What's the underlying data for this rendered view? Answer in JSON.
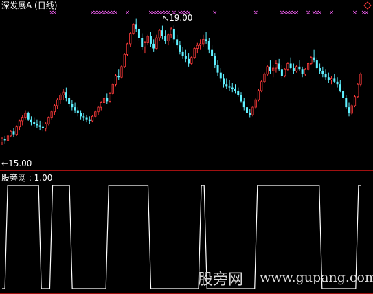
{
  "window": {
    "title": "深发展A (日线)"
  },
  "indicator": {
    "label": "股旁网 : 1.00"
  },
  "watermark": {
    "cn": "股旁网",
    "url": "www.gupang.com"
  },
  "annotations": {
    "high": "19.00",
    "low": "15.00"
  },
  "colors": {
    "up": "#ff3b3b",
    "down": "#5ff0ff",
    "marker": "#ff66ff",
    "divider": "#a01010",
    "signal": "#ffffff",
    "diamond": "#ff3b3b"
  },
  "chart_data": [
    {
      "type": "candlestick",
      "title": "深发展A (日线)",
      "ylim": [
        14.8,
        19.4
      ],
      "annotations": [
        {
          "label": "19.00",
          "index": 59,
          "value": 19.0
        },
        {
          "label": "15.00",
          "index": 0,
          "value": 15.0
        }
      ],
      "values": [
        [
          15.15,
          15.3,
          15.05,
          15.25
        ],
        [
          15.25,
          15.35,
          15.1,
          15.2
        ],
        [
          15.2,
          15.4,
          15.15,
          15.35
        ],
        [
          15.35,
          15.55,
          15.3,
          15.5
        ],
        [
          15.5,
          15.6,
          15.3,
          15.4
        ],
        [
          15.4,
          15.7,
          15.35,
          15.65
        ],
        [
          15.65,
          15.9,
          15.55,
          15.85
        ],
        [
          15.85,
          16.05,
          15.7,
          15.95
        ],
        [
          15.95,
          16.2,
          15.9,
          16.1
        ],
        [
          16.1,
          16.15,
          15.85,
          15.9
        ],
        [
          15.9,
          16.0,
          15.7,
          15.8
        ],
        [
          15.8,
          15.95,
          15.65,
          15.75
        ],
        [
          15.75,
          15.9,
          15.6,
          15.7
        ],
        [
          15.7,
          15.85,
          15.55,
          15.65
        ],
        [
          15.65,
          15.8,
          15.5,
          15.6
        ],
        [
          15.6,
          15.8,
          15.5,
          15.75
        ],
        [
          15.75,
          16.0,
          15.7,
          15.95
        ],
        [
          15.95,
          16.2,
          15.9,
          16.15
        ],
        [
          16.15,
          16.4,
          16.05,
          16.35
        ],
        [
          16.35,
          16.6,
          16.25,
          16.55
        ],
        [
          16.55,
          16.75,
          16.4,
          16.7
        ],
        [
          16.7,
          16.9,
          16.55,
          16.8
        ],
        [
          16.8,
          16.95,
          16.5,
          16.6
        ],
        [
          16.6,
          16.7,
          16.3,
          16.4
        ],
        [
          16.4,
          16.55,
          16.2,
          16.3
        ],
        [
          16.3,
          16.45,
          16.1,
          16.2
        ],
        [
          16.2,
          16.3,
          16.0,
          16.1
        ],
        [
          16.1,
          16.2,
          15.9,
          16.0
        ],
        [
          16.0,
          16.1,
          15.85,
          15.95
        ],
        [
          15.95,
          16.05,
          15.8,
          15.9
        ],
        [
          15.9,
          16.0,
          15.75,
          15.85
        ],
        [
          15.85,
          16.05,
          15.8,
          16.0
        ],
        [
          16.0,
          16.2,
          15.95,
          16.15
        ],
        [
          16.15,
          16.35,
          16.05,
          16.3
        ],
        [
          16.3,
          16.5,
          16.2,
          16.45
        ],
        [
          16.45,
          16.65,
          16.35,
          16.6
        ],
        [
          16.6,
          16.75,
          16.4,
          16.5
        ],
        [
          16.5,
          16.8,
          16.45,
          16.75
        ],
        [
          16.75,
          17.1,
          16.7,
          17.05
        ],
        [
          17.05,
          17.4,
          17.0,
          17.35
        ],
        [
          17.35,
          17.55,
          17.2,
          17.3
        ],
        [
          17.3,
          17.7,
          17.25,
          17.65
        ],
        [
          17.65,
          18.1,
          17.6,
          18.05
        ],
        [
          18.05,
          18.45,
          18.0,
          18.4
        ],
        [
          18.4,
          18.8,
          18.3,
          18.75
        ],
        [
          18.75,
          19.1,
          18.7,
          19.05
        ],
        [
          19.05,
          19.25,
          18.8,
          18.9
        ],
        [
          18.9,
          19.0,
          18.5,
          18.6
        ],
        [
          18.6,
          18.75,
          18.2,
          18.3
        ],
        [
          18.3,
          18.5,
          18.1,
          18.45
        ],
        [
          18.45,
          18.7,
          18.35,
          18.65
        ],
        [
          18.65,
          18.8,
          18.3,
          18.4
        ],
        [
          18.4,
          18.55,
          18.15,
          18.25
        ],
        [
          18.25,
          18.7,
          18.2,
          18.6
        ],
        [
          18.6,
          18.9,
          18.5,
          18.85
        ],
        [
          18.85,
          19.0,
          18.55,
          18.65
        ],
        [
          18.65,
          18.85,
          18.4,
          18.5
        ],
        [
          18.5,
          18.75,
          18.35,
          18.7
        ],
        [
          18.7,
          18.95,
          18.6,
          18.9
        ],
        [
          18.9,
          19.0,
          18.45,
          18.55
        ],
        [
          18.55,
          18.7,
          18.25,
          18.35
        ],
        [
          18.35,
          18.5,
          18.05,
          18.15
        ],
        [
          18.15,
          18.3,
          17.9,
          18.0
        ],
        [
          18.0,
          18.2,
          17.8,
          17.9
        ],
        [
          17.9,
          18.1,
          17.65,
          17.75
        ],
        [
          17.75,
          18.0,
          17.7,
          17.95
        ],
        [
          17.95,
          18.3,
          17.9,
          18.25
        ],
        [
          18.25,
          18.45,
          18.1,
          18.35
        ],
        [
          18.35,
          18.55,
          18.2,
          18.4
        ],
        [
          18.4,
          18.7,
          18.3,
          18.55
        ],
        [
          18.55,
          18.8,
          18.4,
          18.5
        ],
        [
          18.5,
          18.6,
          18.1,
          18.2
        ],
        [
          18.2,
          18.35,
          17.9,
          18.0
        ],
        [
          18.0,
          18.1,
          17.6,
          17.7
        ],
        [
          17.7,
          17.85,
          17.35,
          17.45
        ],
        [
          17.45,
          17.6,
          17.15,
          17.25
        ],
        [
          17.25,
          17.4,
          16.95,
          17.05
        ],
        [
          17.05,
          17.25,
          16.9,
          17.0
        ],
        [
          17.0,
          17.2,
          16.85,
          16.95
        ],
        [
          16.95,
          17.1,
          16.8,
          16.9
        ],
        [
          16.9,
          17.05,
          16.75,
          16.85
        ],
        [
          16.85,
          16.95,
          16.65,
          16.7
        ],
        [
          16.7,
          16.8,
          16.45,
          16.5
        ],
        [
          16.5,
          16.6,
          16.2,
          16.3
        ],
        [
          16.3,
          16.4,
          16.05,
          16.1
        ],
        [
          16.1,
          16.25,
          15.95,
          16.05
        ],
        [
          16.05,
          16.35,
          16.0,
          16.3
        ],
        [
          16.3,
          16.6,
          16.25,
          16.55
        ],
        [
          16.55,
          16.9,
          16.5,
          16.85
        ],
        [
          16.85,
          17.2,
          16.8,
          17.15
        ],
        [
          17.15,
          17.45,
          17.1,
          17.4
        ],
        [
          17.4,
          17.7,
          17.35,
          17.65
        ],
        [
          17.65,
          17.85,
          17.4,
          17.5
        ],
        [
          17.5,
          17.7,
          17.3,
          17.6
        ],
        [
          17.6,
          17.85,
          17.45,
          17.75
        ],
        [
          17.75,
          17.9,
          17.5,
          17.55
        ],
        [
          17.55,
          17.7,
          17.25,
          17.35
        ],
        [
          17.35,
          17.6,
          17.3,
          17.55
        ],
        [
          17.55,
          17.8,
          17.5,
          17.75
        ],
        [
          17.75,
          17.95,
          17.55,
          17.6
        ],
        [
          17.6,
          17.75,
          17.4,
          17.5
        ],
        [
          17.5,
          17.7,
          17.45,
          17.65
        ],
        [
          17.65,
          17.85,
          17.5,
          17.55
        ],
        [
          17.55,
          17.65,
          17.3,
          17.4
        ],
        [
          17.4,
          17.6,
          17.35,
          17.55
        ],
        [
          17.55,
          17.8,
          17.5,
          17.75
        ],
        [
          17.75,
          18.0,
          17.7,
          17.95
        ],
        [
          17.95,
          18.2,
          17.8,
          17.85
        ],
        [
          17.85,
          17.95,
          17.55,
          17.6
        ],
        [
          17.6,
          17.75,
          17.4,
          17.5
        ],
        [
          17.5,
          17.65,
          17.3,
          17.4
        ],
        [
          17.4,
          17.55,
          17.2,
          17.3
        ],
        [
          17.3,
          17.45,
          17.1,
          17.2
        ],
        [
          17.2,
          17.35,
          17.05,
          17.25
        ],
        [
          17.25,
          17.4,
          17.1,
          17.15
        ],
        [
          17.15,
          17.3,
          16.95,
          17.05
        ],
        [
          17.05,
          17.2,
          16.8,
          16.85
        ],
        [
          16.85,
          16.95,
          16.55,
          16.6
        ],
        [
          16.6,
          16.7,
          16.25,
          16.3
        ],
        [
          16.3,
          16.45,
          16.0,
          16.1
        ],
        [
          16.1,
          16.4,
          16.05,
          16.35
        ],
        [
          16.35,
          16.7,
          16.3,
          16.65
        ],
        [
          16.65,
          17.1,
          16.6,
          17.05
        ],
        [
          17.05,
          17.45,
          17.0,
          17.4
        ]
      ],
      "markers": [
        17,
        18,
        31,
        32,
        33,
        34,
        35,
        36,
        37,
        38,
        39,
        43,
        51,
        52,
        53,
        54,
        55,
        56,
        57,
        59,
        61,
        62,
        63,
        64,
        73,
        87,
        96,
        97,
        98,
        99,
        100,
        101,
        105,
        107,
        108,
        109,
        113,
        121,
        124,
        125
      ]
    },
    {
      "type": "step",
      "title": "股旁网",
      "value_label": "1.00",
      "ylim": [
        0,
        1
      ],
      "values": [
        0,
        0,
        1,
        1,
        1,
        1,
        1,
        1,
        1,
        1,
        1,
        1,
        1,
        1,
        0,
        0,
        0,
        0,
        1,
        1,
        1,
        1,
        1,
        1,
        1,
        0,
        0,
        0,
        0,
        0,
        0,
        0,
        0,
        0,
        0,
        0,
        0,
        0,
        1,
        1,
        1,
        1,
        1,
        1,
        1,
        1,
        1,
        1,
        1,
        1,
        1,
        1,
        1,
        0,
        0,
        0,
        0,
        0,
        0,
        0,
        0,
        0,
        0,
        0,
        0,
        0,
        0,
        0,
        0,
        0,
        0,
        1,
        1,
        0,
        0,
        0,
        0,
        0,
        0,
        0,
        0,
        0,
        0,
        0,
        0,
        0,
        0,
        0,
        0,
        0,
        0,
        1,
        1,
        1,
        1,
        1,
        1,
        1,
        1,
        1,
        1,
        1,
        1,
        1,
        1,
        1,
        1,
        1,
        1,
        1,
        1,
        1,
        1,
        1,
        0,
        0,
        0,
        0,
        0,
        0,
        0,
        0,
        0,
        0,
        0,
        0,
        0,
        1,
        1
      ]
    }
  ]
}
